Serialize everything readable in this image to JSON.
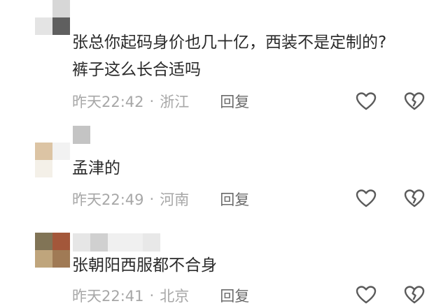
{
  "comments": [
    {
      "lines": [
        "张总你起码身价也几十亿，西装不是定制的?",
        "裤子这么长合适吗"
      ],
      "time": "昨天22:42",
      "location": "浙江",
      "reply_label": "回复",
      "avatar_colors": [
        "#ffffff",
        "#d7d7d7",
        "#e4e4e4",
        "#5f5f5f"
      ],
      "username_colors": []
    },
    {
      "lines": [
        "孟津的"
      ],
      "time": "昨天22:49",
      "location": "河南",
      "reply_label": "回复",
      "avatar_colors": [
        "#ffffff",
        "#ffffff",
        "#dcc4a4",
        "#f2f2f2"
      ],
      "username_colors": [
        "#c4c4c4",
        "#ffffff"
      ]
    },
    {
      "lines": [
        "张朝阳西服都不合身"
      ],
      "time": "昨天22:41",
      "location": "北京",
      "reply_label": "回复",
      "avatar_colors": [
        "#817456",
        "#a3573a",
        "#bfa57c",
        "#a07a55"
      ],
      "username_colors": [
        "#e6e6e6",
        "#d0d0d0",
        "#f0f0f0",
        "#e8e8e8"
      ]
    }
  ],
  "separator": "·",
  "icons": {
    "like": "heart-outline-icon",
    "dislike": "broken-heart-outline-icon",
    "icon_color": "#5b5b5b"
  }
}
